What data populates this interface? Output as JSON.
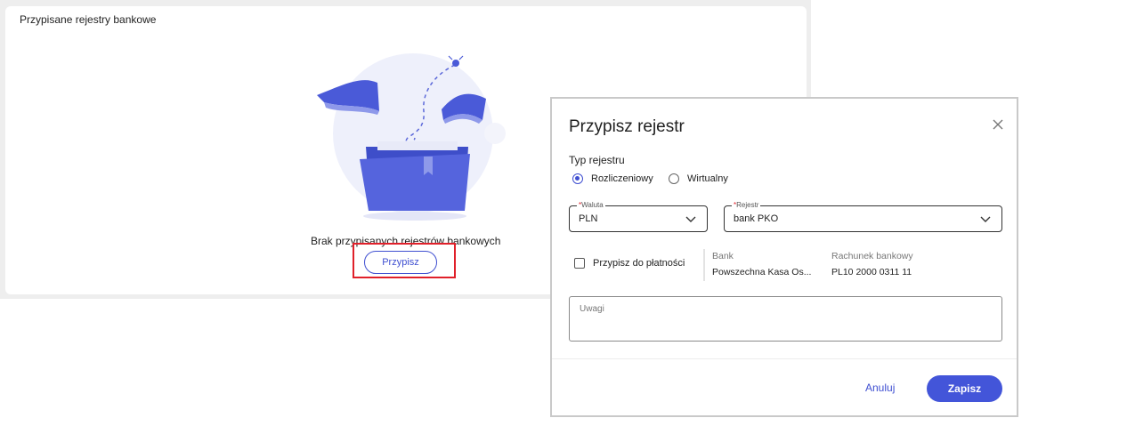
{
  "card": {
    "title": "Przypisane rejestry bankowe",
    "empty_text": "Brak przypisanych rejestrów bankowych",
    "assign_button_label": "Przypisz"
  },
  "modal": {
    "title": "Przypisz rejestr",
    "register_type_label": "Typ rejestru",
    "radio_options": [
      {
        "label": "Rozliczeniowy",
        "checked": true
      },
      {
        "label": "Wirtualny",
        "checked": false
      }
    ],
    "currency": {
      "label": "Waluta",
      "required_mark": "*",
      "value": "PLN"
    },
    "register": {
      "label": "Rejestr",
      "required_mark": "*",
      "value": "bank PKO"
    },
    "assign_to_payments_label": "Przypisz do płatności",
    "assign_to_payments_checked": false,
    "bank": {
      "label": "Bank",
      "value": "Powszechna Kasa Os..."
    },
    "account": {
      "label": "Rachunek bankowy",
      "value": "PL10 2000 0311 11"
    },
    "notes_placeholder": "Uwagi",
    "cancel_label": "Anuluj",
    "save_label": "Zapisz"
  },
  "colors": {
    "accent": "#4355d9",
    "highlight": "#e0202a"
  },
  "icons": [
    "folder-illustration",
    "close-icon",
    "chevron-down-icon"
  ]
}
